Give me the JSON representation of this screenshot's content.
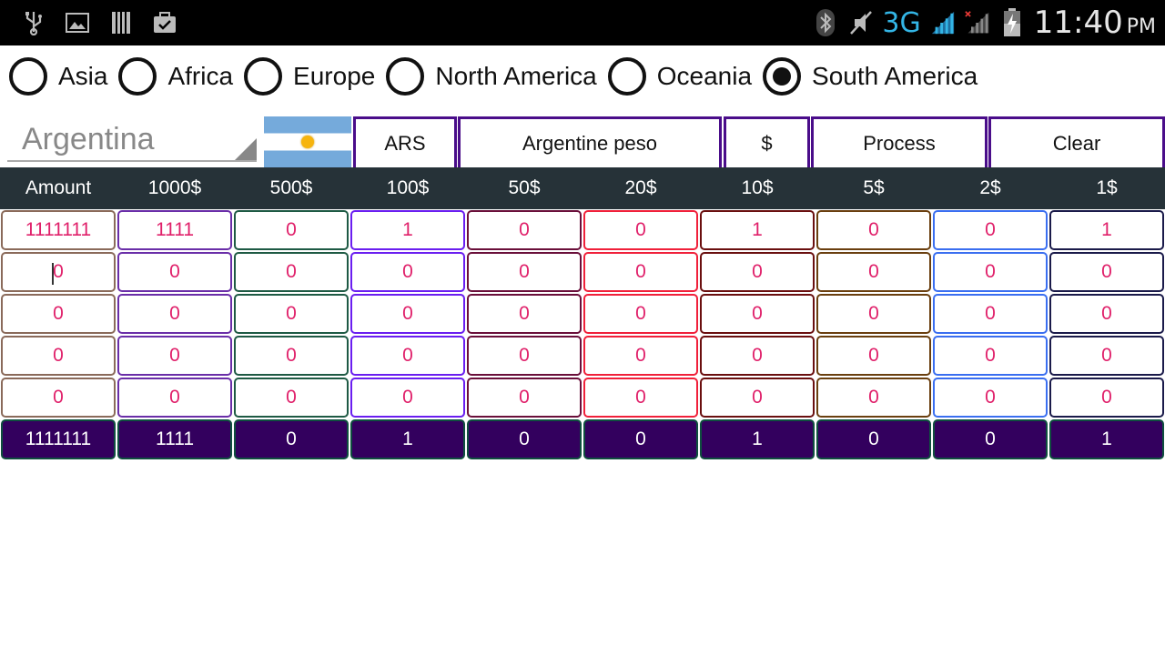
{
  "statusbar": {
    "icons_left": [
      "usb-icon",
      "image-icon",
      "sd-card-icon",
      "briefcase-icon"
    ],
    "network": "3G",
    "time": "11:40",
    "ampm": "PM"
  },
  "continents": [
    {
      "label": "Asia",
      "checked": false
    },
    {
      "label": "Africa",
      "checked": false
    },
    {
      "label": "Europe",
      "checked": false
    },
    {
      "label": "North America",
      "checked": false
    },
    {
      "label": "Oceania",
      "checked": false
    },
    {
      "label": "South America",
      "checked": true
    }
  ],
  "toolbar": {
    "country": "Argentina",
    "currency_code": "ARS",
    "currency_name": "Argentine peso",
    "symbol": "$",
    "process_label": "Process",
    "clear_label": "Clear"
  },
  "header": [
    "Amount",
    "1000$",
    "500$",
    "100$",
    "50$",
    "20$",
    "10$",
    "5$",
    "2$",
    "1$"
  ],
  "column_colors": [
    "#8a6a5a",
    "#6a2ea8",
    "#1e5a44",
    "#6a1ef0",
    "#6a0f3a",
    "#f0203a",
    "#6a0f0f",
    "#6a3f0f",
    "#3a6ef0",
    "#1a1a4a"
  ],
  "rows": [
    [
      "1111111",
      "1111",
      "0",
      "1",
      "0",
      "0",
      "1",
      "0",
      "0",
      "1"
    ],
    [
      "0",
      "0",
      "0",
      "0",
      "0",
      "0",
      "0",
      "0",
      "0",
      "0"
    ],
    [
      "0",
      "0",
      "0",
      "0",
      "0",
      "0",
      "0",
      "0",
      "0",
      "0"
    ],
    [
      "0",
      "0",
      "0",
      "0",
      "0",
      "0",
      "0",
      "0",
      "0",
      "0"
    ],
    [
      "0",
      "0",
      "0",
      "0",
      "0",
      "0",
      "0",
      "0",
      "0",
      "0"
    ]
  ],
  "totals": [
    "1111111",
    "1111",
    "0",
    "1",
    "0",
    "0",
    "1",
    "0",
    "0",
    "1"
  ]
}
